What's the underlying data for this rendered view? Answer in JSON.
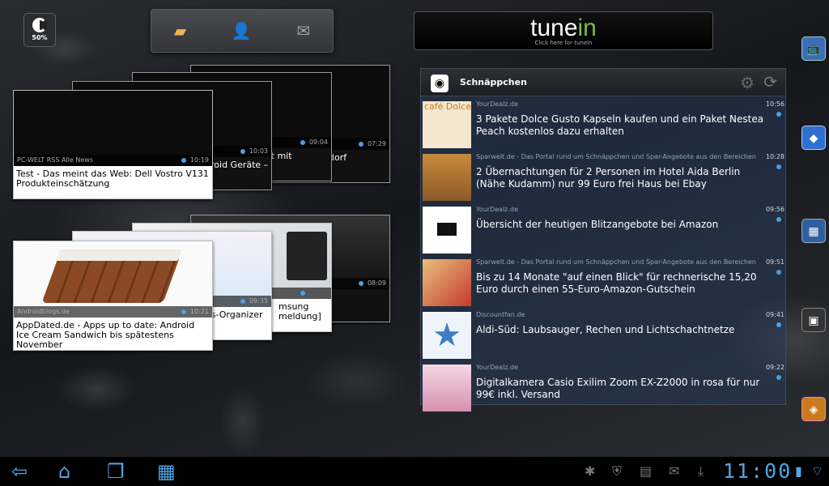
{
  "battery": {
    "percent": "50%"
  },
  "contact_widget": {
    "icons": [
      "note-icon",
      "person-icon",
      "mail-icon"
    ]
  },
  "tunein": {
    "logo_main": "tune",
    "logo_accent": "in",
    "tagline": "Click here for tunein"
  },
  "news_stack": {
    "back_cards": [
      {
        "time": "07:29",
        "caption_fragment": "dorf"
      },
      {
        "time": "09:04",
        "caption_fragment": "uft mit"
      },
      {
        "time": "10:03",
        "caption_fragment": "roid Geräte –"
      }
    ],
    "front": {
      "source": "PC-WELT RSS Alle News",
      "time": "10:19",
      "caption": "Test - Das meint das Web: Dell Vostro V131 Produkteinschätzung"
    }
  },
  "apps_stack": {
    "back_cards": [
      {
        "time": "08:09",
        "caption_fragment": ""
      },
      {
        "time": "",
        "caption_fragment": "msung\nmeldung]"
      },
      {
        "time": "09:35",
        "caption_fragment": "ss-Organizer"
      }
    ],
    "front": {
      "source": "Androidblogs.de",
      "time": "10:21",
      "caption": "AppDated.de - Apps up to date: Android Ice Cream Sandwich bis spätestens November"
    }
  },
  "feed": {
    "title": "Schnäppchen",
    "items": [
      {
        "source": "YourDealz.de",
        "time": "10:56",
        "text": "3 Pakete Dolce Gusto Kapseln kaufen und ein Paket Nestea Peach kostenlos dazu erhalten",
        "thumb": "café Dolce"
      },
      {
        "source": "Sparwelt.de - Das Portal rund um Schnäppchen und Spar-Angebote aus den Bereichen",
        "time": "10:28",
        "text": "2 Übernachtungen für 2 Personen im Hotel Aida Berlin (Nähe Kudamm) nur 99 Euro frei Haus bei Ebay",
        "thumb": ""
      },
      {
        "source": "YourDealz.de",
        "time": "09:56",
        "text": "Übersicht der heutigen Blitzangebote bei Amazon",
        "thumb": ""
      },
      {
        "source": "Sparwelt.de - Das Portal rund um Schnäppchen und Spar-Angebote aus den Bereichen",
        "time": "09:51",
        "text": "Bis zu 14 Monate \"auf einen Blick\" für rechnerische 15,20 Euro durch einen 55-Euro-Amazon-Gutschein",
        "thumb": ""
      },
      {
        "source": "Discountfan.de",
        "time": "09:41",
        "text": "Aldi-Süd: Laubsauger, Rechen und Lichtschachtnetze",
        "thumb": ""
      },
      {
        "source": "YourDealz.de",
        "time": "09:22",
        "text": "Digitalkamera Casio Exilim Zoom EX-Z2000 in rosa für nur 99€ inkl. Versand",
        "thumb": ""
      }
    ]
  },
  "right_icons": [
    "tv-icon",
    "cube-app-icon",
    "blocks-icon",
    "box-icon",
    "orange-cube-icon"
  ],
  "system_bar": {
    "clock": "11:00"
  }
}
